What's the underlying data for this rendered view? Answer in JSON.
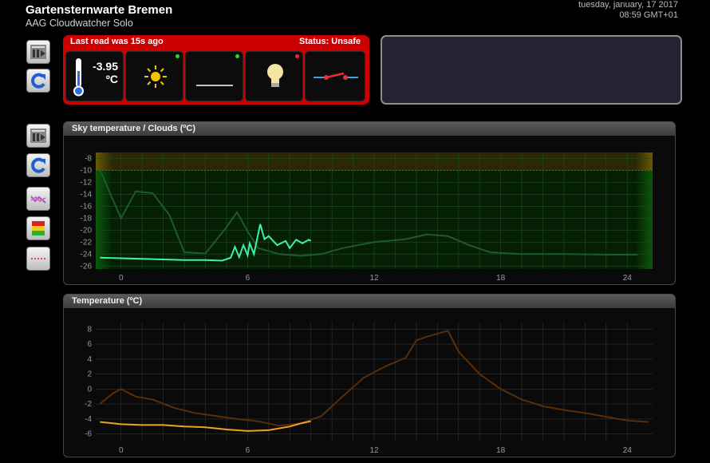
{
  "header": {
    "title": "Gartensternwarte Bremen",
    "subtitle": "AAG Cloudwatcher Solo",
    "date": "tuesday, january, 17 2017",
    "time": "08:59 GMT+01"
  },
  "status": {
    "last_read": "Last read was 15s ago",
    "status_text": "Status: Unsafe",
    "temperature_value": "-3.95",
    "temperature_unit": "ºC",
    "indicators": [
      {
        "icon": "thermometer-icon",
        "dot": ""
      },
      {
        "icon": "sun-icon",
        "dot": "#22dd22"
      },
      {
        "icon": "line-icon",
        "dot": "#22dd22"
      },
      {
        "icon": "light-bulb-icon",
        "dot": "#ff2222"
      },
      {
        "icon": "switch-icon",
        "dot": ""
      }
    ]
  },
  "sky_chart": {
    "title": "Sky temperature / Clouds (ºC)",
    "y_ticks": [
      "-8",
      "-10",
      "-12",
      "-14",
      "-16",
      "-18",
      "-20",
      "-22",
      "-24",
      "-26"
    ],
    "x_ticks": [
      "0",
      "6",
      "12",
      "18",
      "24"
    ],
    "y_range": [
      -26.5,
      -7
    ],
    "x_range": [
      -1.2,
      25.2
    ],
    "threshold": -10,
    "today_series": [
      [
        -1,
        -24.6
      ],
      [
        0,
        -24.7
      ],
      [
        1,
        -24.8
      ],
      [
        2,
        -24.9
      ],
      [
        3,
        -25.0
      ],
      [
        4,
        -25.0
      ],
      [
        4.8,
        -25.1
      ],
      [
        5.2,
        -24.6
      ],
      [
        5.4,
        -22.8
      ],
      [
        5.6,
        -24.5
      ],
      [
        5.8,
        -22.5
      ],
      [
        6.0,
        -24.2
      ],
      [
        6.1,
        -22.2
      ],
      [
        6.3,
        -24.0
      ],
      [
        6.6,
        -19.0
      ],
      [
        6.8,
        -21.5
      ],
      [
        7.0,
        -21.0
      ],
      [
        7.4,
        -22.5
      ],
      [
        7.8,
        -21.8
      ],
      [
        8.0,
        -23.0
      ],
      [
        8.3,
        -21.6
      ],
      [
        8.6,
        -22.2
      ],
      [
        8.9,
        -21.6
      ],
      [
        9.0,
        -21.8
      ]
    ],
    "yesterday_series": [
      [
        -1,
        -10.0
      ],
      [
        -0.8,
        -11.5
      ],
      [
        -0.5,
        -14.0
      ],
      [
        0,
        -18.0
      ],
      [
        0.7,
        -13.5
      ],
      [
        1.5,
        -13.8
      ],
      [
        2.3,
        -17.5
      ],
      [
        2.8,
        -22.0
      ],
      [
        3.0,
        -23.7
      ],
      [
        4.0,
        -23.9
      ],
      [
        5.0,
        -19.5
      ],
      [
        5.5,
        -17.0
      ],
      [
        6.0,
        -20.2
      ],
      [
        6.5,
        -23.0
      ],
      [
        7.5,
        -24.0
      ],
      [
        8.5,
        -24.3
      ],
      [
        9.5,
        -24.0
      ],
      [
        10.5,
        -23.0
      ],
      [
        12.0,
        -22.0
      ],
      [
        13.5,
        -21.5
      ],
      [
        14.5,
        -20.7
      ],
      [
        15.5,
        -21.0
      ],
      [
        16.5,
        -22.5
      ],
      [
        17.5,
        -23.7
      ],
      [
        19.0,
        -24.0
      ],
      [
        21.0,
        -24.0
      ],
      [
        23.0,
        -24.1
      ],
      [
        24.5,
        -24.1
      ]
    ]
  },
  "temp_chart": {
    "title": "Temperature (ºC)",
    "y_ticks": [
      "8",
      "6",
      "4",
      "2",
      "0",
      "-2",
      "-4",
      "-6"
    ],
    "x_ticks": [
      "0",
      "6",
      "12",
      "18",
      "24"
    ],
    "y_range": [
      -7,
      9
    ],
    "x_range": [
      -1.2,
      25.2
    ],
    "today_series": [
      [
        -1,
        -4.4
      ],
      [
        0,
        -4.7
      ],
      [
        1,
        -4.8
      ],
      [
        2,
        -4.8
      ],
      [
        3,
        -5.0
      ],
      [
        4,
        -5.1
      ],
      [
        5,
        -5.4
      ],
      [
        6,
        -5.6
      ],
      [
        7,
        -5.5
      ],
      [
        8,
        -5.0
      ],
      [
        8.5,
        -4.6
      ],
      [
        9,
        -4.3
      ]
    ],
    "yesterday_series": [
      [
        -1,
        -2.0
      ],
      [
        -0.4,
        -0.6
      ],
      [
        0,
        0.0
      ],
      [
        0.7,
        -1.0
      ],
      [
        1.5,
        -1.4
      ],
      [
        2.5,
        -2.5
      ],
      [
        3.5,
        -3.2
      ],
      [
        4.5,
        -3.6
      ],
      [
        5.5,
        -4.0
      ],
      [
        6.5,
        -4.3
      ],
      [
        7.5,
        -4.9
      ],
      [
        8.5,
        -4.6
      ],
      [
        9.5,
        -3.6
      ],
      [
        10.5,
        -1.0
      ],
      [
        11.5,
        1.5
      ],
      [
        12.5,
        3.0
      ],
      [
        13.5,
        4.2
      ],
      [
        14,
        6.5
      ],
      [
        14.5,
        7.0
      ],
      [
        15.5,
        7.8
      ],
      [
        16,
        5.0
      ],
      [
        17,
        2.0
      ],
      [
        18,
        0.0
      ],
      [
        19,
        -1.4
      ],
      [
        20,
        -2.3
      ],
      [
        21,
        -2.8
      ],
      [
        22,
        -3.2
      ],
      [
        23,
        -3.7
      ],
      [
        24,
        -4.2
      ],
      [
        25,
        -4.4
      ]
    ]
  },
  "colors": {
    "status_red": "#cc0000",
    "sky_today": "#3ef0a8",
    "sky_yesterday": "#1d5a2c",
    "temp_today": "#f0a020",
    "temp_yesterday": "#5a2e06"
  }
}
